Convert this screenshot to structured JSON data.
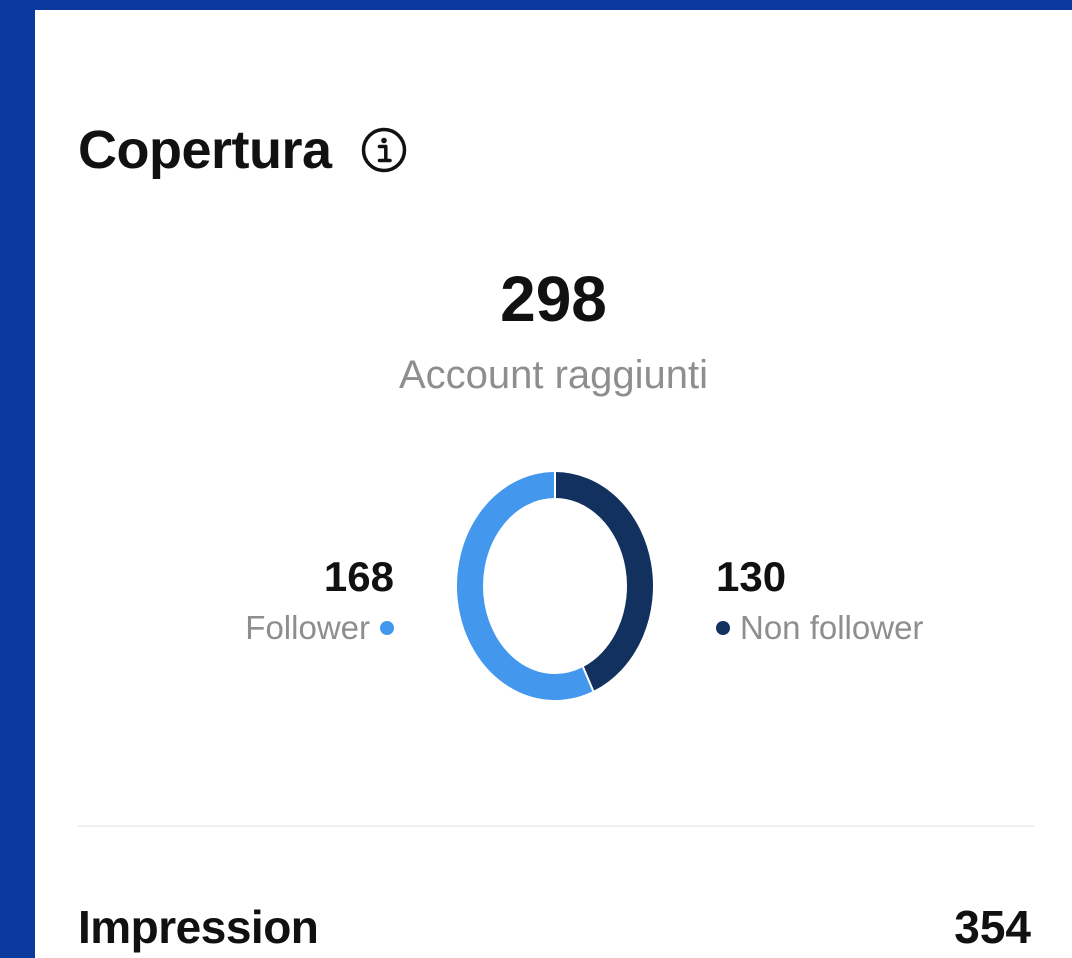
{
  "reach": {
    "title": "Copertura",
    "total": "298",
    "total_label": "Account raggiunti",
    "followers": {
      "value": "168",
      "label": "Follower",
      "color": "#4398EE"
    },
    "non_followers": {
      "value": "130",
      "label": "Non follower",
      "color": "#12315F"
    }
  },
  "impressions": {
    "label": "Impression",
    "value": "354"
  },
  "colors": {
    "background": "#0A3A9E",
    "card": "#FFFFFF",
    "divider": "#EFEFEF"
  },
  "icons": {
    "title_icon": "info-icon"
  },
  "chart_data": {
    "type": "pie",
    "categories": [
      "Follower",
      "Non follower"
    ],
    "values": [
      168,
      130
    ],
    "colors": [
      "#4398EE",
      "#12315F"
    ]
  }
}
